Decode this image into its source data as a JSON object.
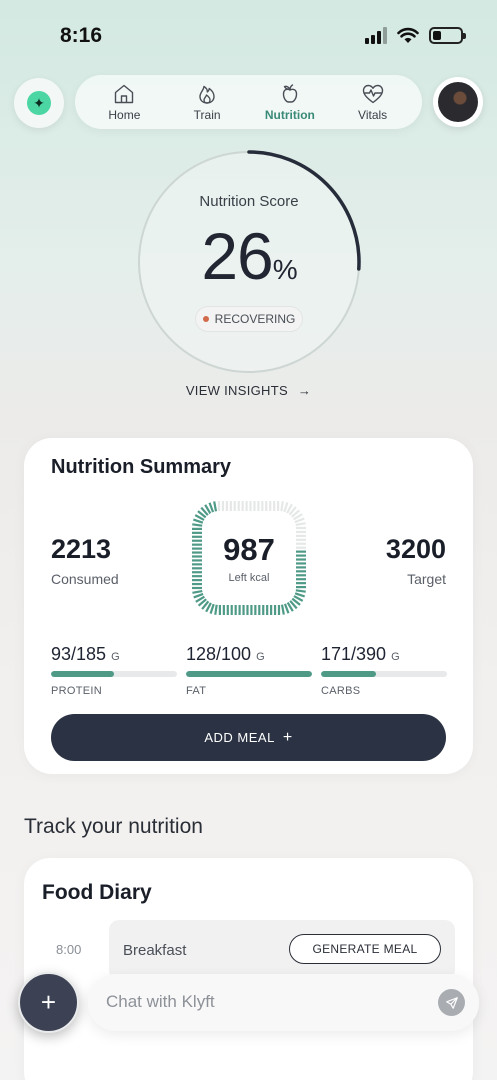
{
  "status_bar": {
    "time": "8:16"
  },
  "nav": {
    "tabs": [
      {
        "label": "Home",
        "icon": "home-icon",
        "active": false
      },
      {
        "label": "Train",
        "icon": "flame-icon",
        "active": false
      },
      {
        "label": "Nutrition",
        "icon": "apple-icon",
        "active": true
      },
      {
        "label": "Vitals",
        "icon": "heart-pulse-icon",
        "active": false
      }
    ]
  },
  "score": {
    "title": "Nutrition Score",
    "value": "26",
    "unit": "%",
    "progress": 0.26,
    "status": "RECOVERING",
    "status_color": "#d1694a"
  },
  "insights": {
    "label": "VIEW INSIGHTS",
    "arrow": "→"
  },
  "summary": {
    "title": "Nutrition Summary",
    "consumed": {
      "value": "2213",
      "label": "Consumed"
    },
    "target": {
      "value": "3200",
      "label": "Target"
    },
    "left": {
      "value": "987",
      "label": "Left kcal",
      "fraction": 0.69
    },
    "macros": [
      {
        "value": "93/185",
        "unit": "G",
        "name": "PROTEIN",
        "fraction": 0.5
      },
      {
        "value": "128/100",
        "unit": "G",
        "name": "FAT",
        "fraction": 1.0
      },
      {
        "value": "171/390",
        "unit": "G",
        "name": "CARBS",
        "fraction": 0.44
      }
    ],
    "add_meal": "ADD MEAL",
    "add_icon": "+",
    "accent": "#4e9a87"
  },
  "track": {
    "title": "Track your nutrition"
  },
  "diary": {
    "title": "Food Diary",
    "entries": [
      {
        "time": "8:00",
        "meal": "Breakfast",
        "action": "GENERATE MEAL"
      }
    ]
  },
  "fab": {
    "icon": "+"
  },
  "chat": {
    "placeholder": "Chat with Klyft"
  }
}
